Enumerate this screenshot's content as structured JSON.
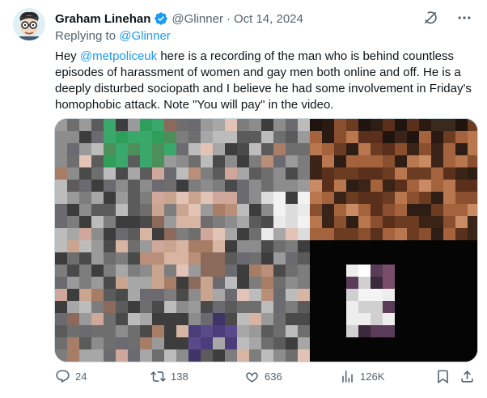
{
  "author": {
    "name": "Graham Linehan",
    "handle": "@Glinner",
    "separator": "·",
    "date": "Oct 14, 2024"
  },
  "reply": {
    "prefix": "Replying to",
    "handle": "@Glinner"
  },
  "body": {
    "greeting": "Hey",
    "mention": "@metpoliceuk",
    "text": "here is a recording of the man who is behind countless episodes of harassment of women and gay men both online and off. He is a deeply disturbed sociopath and I believe he had some involvement in Friday's homophobic attack. Note \"You will pay\" in the video."
  },
  "actions": {
    "replies": "24",
    "reposts": "138",
    "likes": "636",
    "views": "126K"
  },
  "colors": {
    "accent": "#1d9bf0",
    "muted": "#536471",
    "verified": "#1d9bf0"
  },
  "icons": {
    "verified": "verified-badge-icon",
    "grok": "grok-icon",
    "more": "more-icon",
    "reply": "reply-icon",
    "repost": "repost-icon",
    "like": "heart-icon",
    "views": "views-icon",
    "bookmark": "bookmark-icon",
    "share": "share-icon"
  }
}
